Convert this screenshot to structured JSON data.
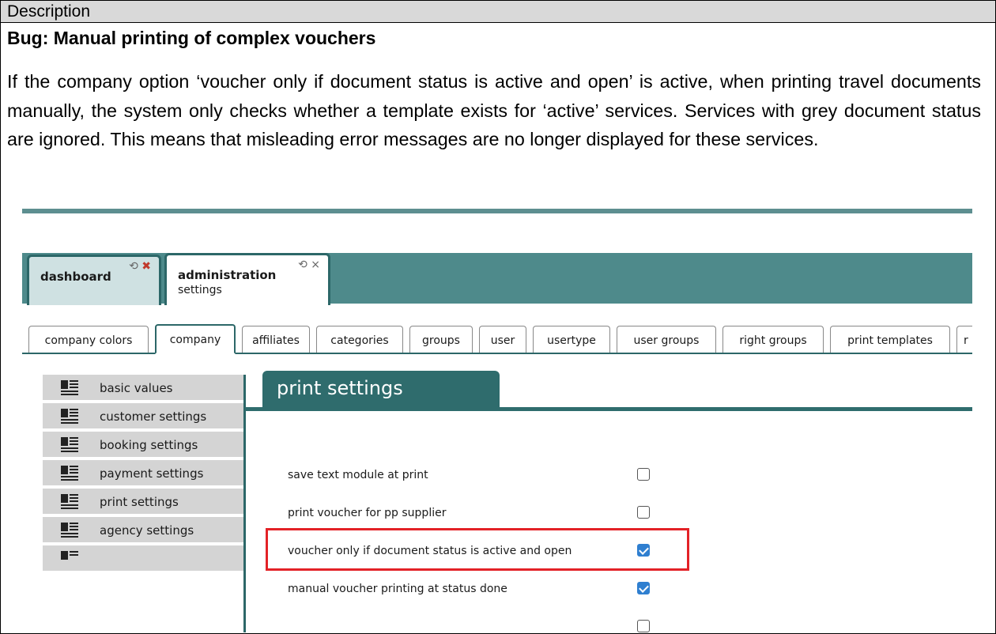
{
  "description_header": "Description",
  "bug_title": "Bug: Manual printing of complex vouchers",
  "paragraph": "If the company option ‘voucher only if document status is active and open’ is active, when printing travel documents manually, the system only checks whether a template exists for ‘active’ services. Services with grey document status are ignored. This means that misleading error messages are no longer displayed for these services.",
  "app": {
    "tabs": [
      {
        "title": "dashboard",
        "subtitle": "",
        "icons": "⟲ ✖"
      },
      {
        "title": "administration",
        "subtitle": "settings",
        "icons": "⟲ ×"
      }
    ],
    "subtabs": [
      "company colors",
      "company",
      "affiliates",
      "categories",
      "groups",
      "user",
      "usertype",
      "user groups",
      "right groups",
      "print templates",
      "r"
    ],
    "active_subtab": "company",
    "sidebar": [
      "basic values",
      "customer settings",
      "booking settings",
      "payment settings",
      "print settings",
      "agency settings"
    ],
    "panel_title": "print settings",
    "settings": [
      {
        "label": "save text module at print",
        "checked": false
      },
      {
        "label": "print voucher for pp supplier",
        "checked": false
      },
      {
        "label": "voucher only if document status is active and open",
        "checked": true
      },
      {
        "label": "manual voucher printing at status done",
        "checked": true
      }
    ],
    "colors": {
      "teal": "#2f6c6d",
      "highlight": "#e32227",
      "checkbox": "#2f7fd0"
    }
  }
}
